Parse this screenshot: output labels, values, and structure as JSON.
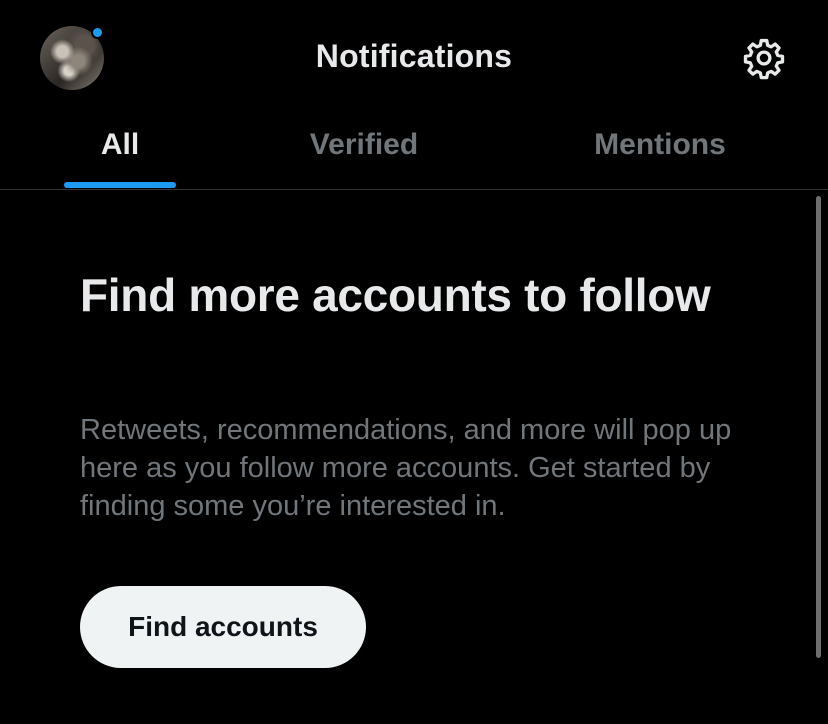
{
  "header": {
    "title": "Notifications",
    "avatar_icon": "user-avatar",
    "settings_icon": "gear-icon",
    "unread_dot_color": "#1d9bf0"
  },
  "tabs": [
    {
      "label": "All",
      "active": true
    },
    {
      "label": "Verified",
      "active": false
    },
    {
      "label": "Mentions",
      "active": false
    }
  ],
  "empty_state": {
    "title": "Find more accounts to follow",
    "body": "Retweets, recommendations, and more will pop up here as you follow more accounts. Get started by finding some you’re interested in.",
    "button_label": "Find accounts"
  },
  "colors": {
    "background": "#000000",
    "accent": "#1d9bf0",
    "primary_text": "#e7e9ea",
    "secondary_text": "#71767b",
    "button_bg": "#eff3f4"
  }
}
